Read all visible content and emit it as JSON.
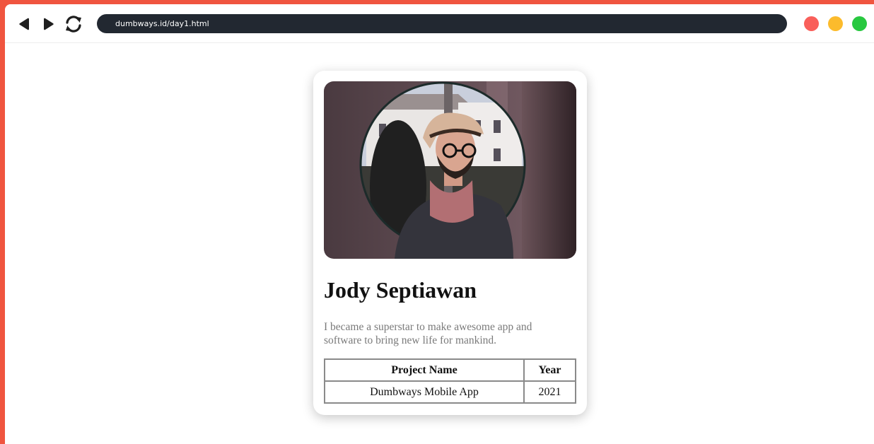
{
  "browser": {
    "url": "dumbways.id/day1.html",
    "nav_icons": [
      "back-arrow-icon",
      "forward-arrow-icon",
      "reload-icon"
    ],
    "window_controls": [
      {
        "name": "close",
        "color": "#f95f5a"
      },
      {
        "name": "minimize",
        "color": "#fcbb2c"
      },
      {
        "name": "maximize",
        "color": "#28c840"
      }
    ],
    "frame_color": "#f0553f"
  },
  "profile": {
    "name": "Jody Septiawan",
    "bio": "I became a superstar to make awesome app and software to bring new life for mankind.",
    "photo_alt": "profile photo"
  },
  "projects": {
    "headers": [
      "Project Name",
      "Year"
    ],
    "rows": [
      [
        "Dumbways Mobile App",
        "2021"
      ]
    ]
  }
}
